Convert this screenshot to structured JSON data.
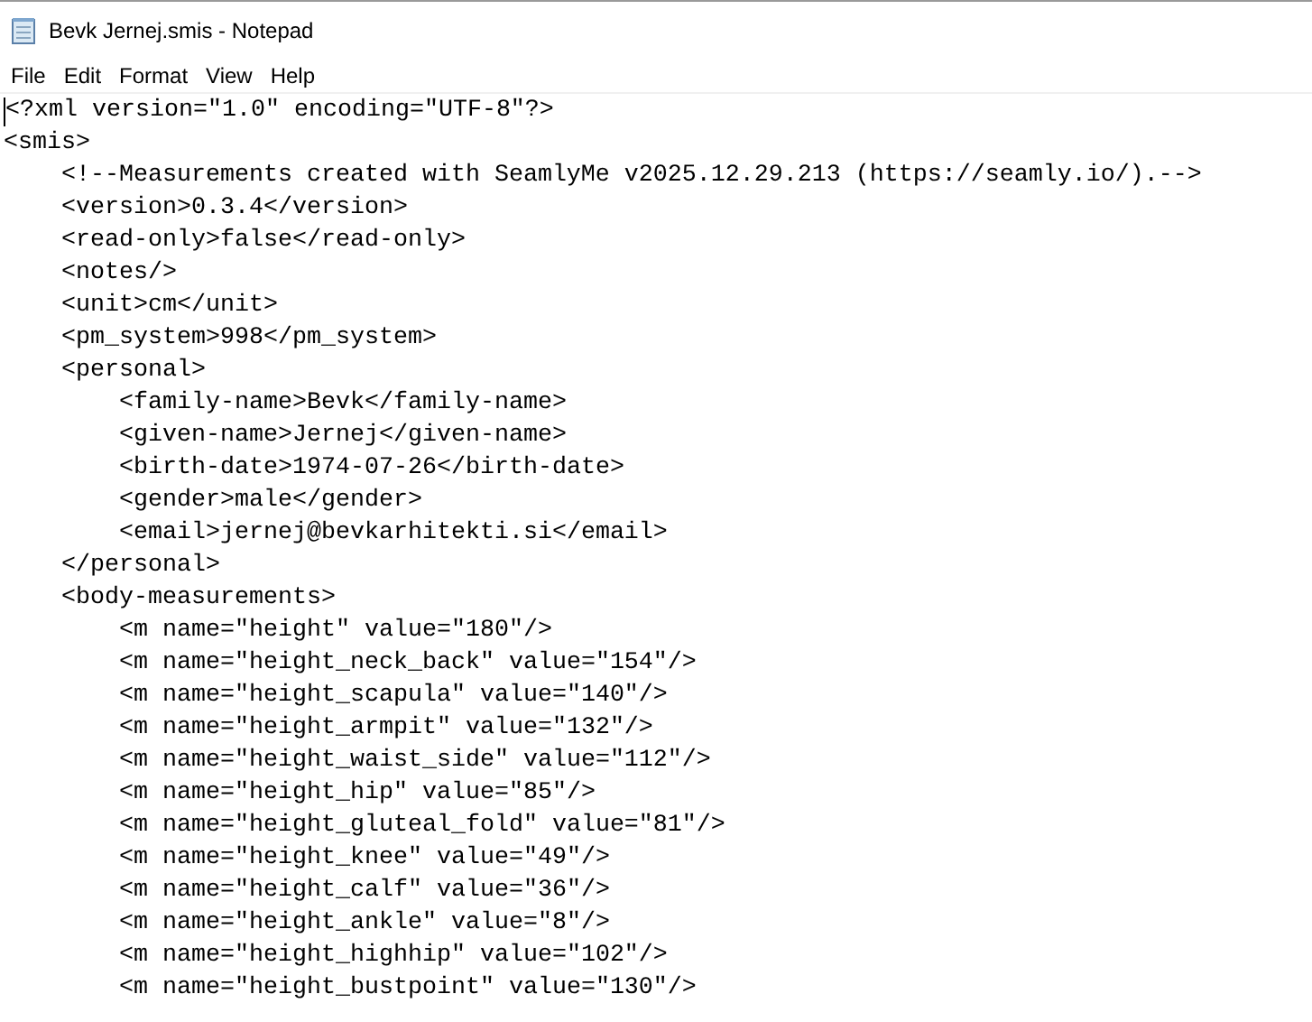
{
  "window": {
    "title": "Bevk Jernej.smis - Notepad"
  },
  "menu": [
    "File",
    "Edit",
    "Format",
    "View",
    "Help"
  ],
  "editor": {
    "lines": [
      {
        "text": "<?xml version=\"1.0\" encoding=\"UTF-8\"?>"
      },
      {
        "text": "<smis>",
        "children": [
          {
            "text": "<!--Measurements created with SeamlyMe v2025.12.29.213 (https://seamly.io/).-->"
          },
          {
            "text": "<version>0.3.4</version>"
          },
          {
            "text": "<read-only>false</read-only>"
          },
          {
            "text": "<notes/>"
          },
          {
            "text": "<unit>cm</unit>"
          },
          {
            "text": "<pm_system>998</pm_system>"
          },
          {
            "text": "<personal>",
            "children": [
              {
                "text": "<family-name>Bevk</family-name>"
              },
              {
                "text": "<given-name>Jernej</given-name>"
              },
              {
                "text": "<birth-date>1974-07-26</birth-date>"
              },
              {
                "text": "<gender>male</gender>"
              },
              {
                "text": "<email>jernej@bevkarhitekti.si</email>"
              }
            ]
          },
          {
            "text": "</personal>"
          },
          {
            "text": "<body-measurements>",
            "children": [
              {
                "text": "<m name=\"height\" value=\"180\"/>"
              },
              {
                "text": "<m name=\"height_neck_back\" value=\"154\"/>"
              },
              {
                "text": "<m name=\"height_scapula\" value=\"140\"/>"
              },
              {
                "text": "<m name=\"height_armpit\" value=\"132\"/>"
              },
              {
                "text": "<m name=\"height_waist_side\" value=\"112\"/>"
              },
              {
                "text": "<m name=\"height_hip\" value=\"85\"/>"
              },
              {
                "text": "<m name=\"height_gluteal_fold\" value=\"81\"/>"
              },
              {
                "text": "<m name=\"height_knee\" value=\"49\"/>"
              },
              {
                "text": "<m name=\"height_calf\" value=\"36\"/>"
              },
              {
                "text": "<m name=\"height_ankle\" value=\"8\"/>"
              },
              {
                "text": "<m name=\"height_highhip\" value=\"102\"/>"
              },
              {
                "text": "<m name=\"height_bustpoint\" value=\"130\"/>"
              }
            ]
          }
        ]
      }
    ]
  }
}
